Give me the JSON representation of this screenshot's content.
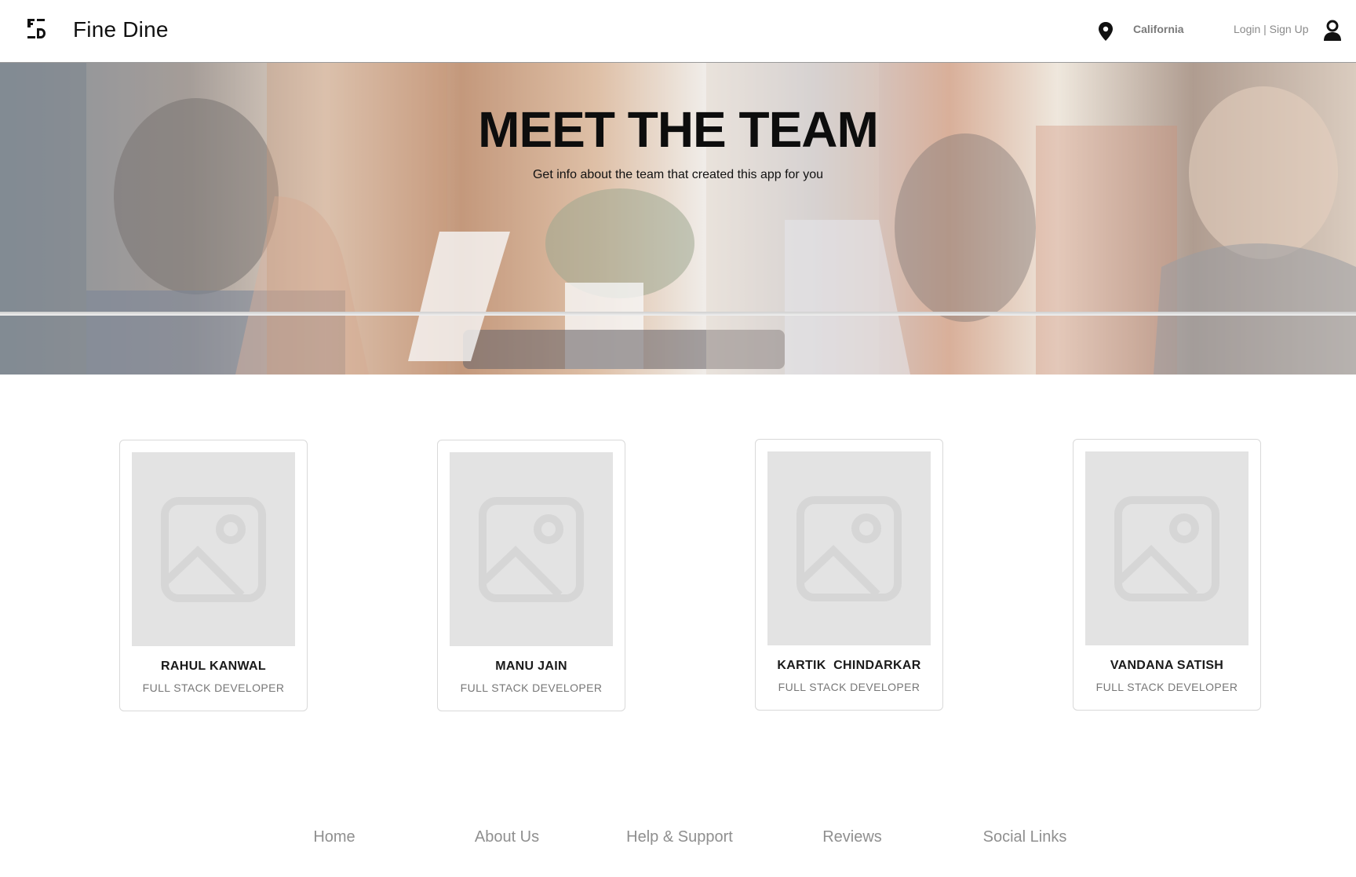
{
  "header": {
    "brand": "Fine Dine",
    "location": "California",
    "login": "Login | Sign Up",
    "icons": [
      "fd-logo-icon",
      "location-pin-icon",
      "user-icon"
    ]
  },
  "hero": {
    "title": "MEET THE TEAM",
    "subtitle": "Get info about the team that created this app for you"
  },
  "team": [
    {
      "name": "RAHUL KANWAL",
      "role": "FULL STACK DEVELOPER"
    },
    {
      "name": "MANU JAIN",
      "role": "FULL STACK DEVELOPER"
    },
    {
      "name": "KARTIK  CHINDARKAR",
      "role": "FULL STACK DEVELOPER"
    },
    {
      "name": "VANDANA SATISH",
      "role": "FULL STACK DEVELOPER"
    }
  ],
  "footer": {
    "links": [
      "Home",
      "About Us",
      "Help & Support",
      "Reviews",
      "Social Links"
    ]
  },
  "colors": {
    "text": "#111111",
    "muted": "#8f8f8f",
    "placeholder": "#e3e3e3",
    "border": "#d9d9d9"
  }
}
